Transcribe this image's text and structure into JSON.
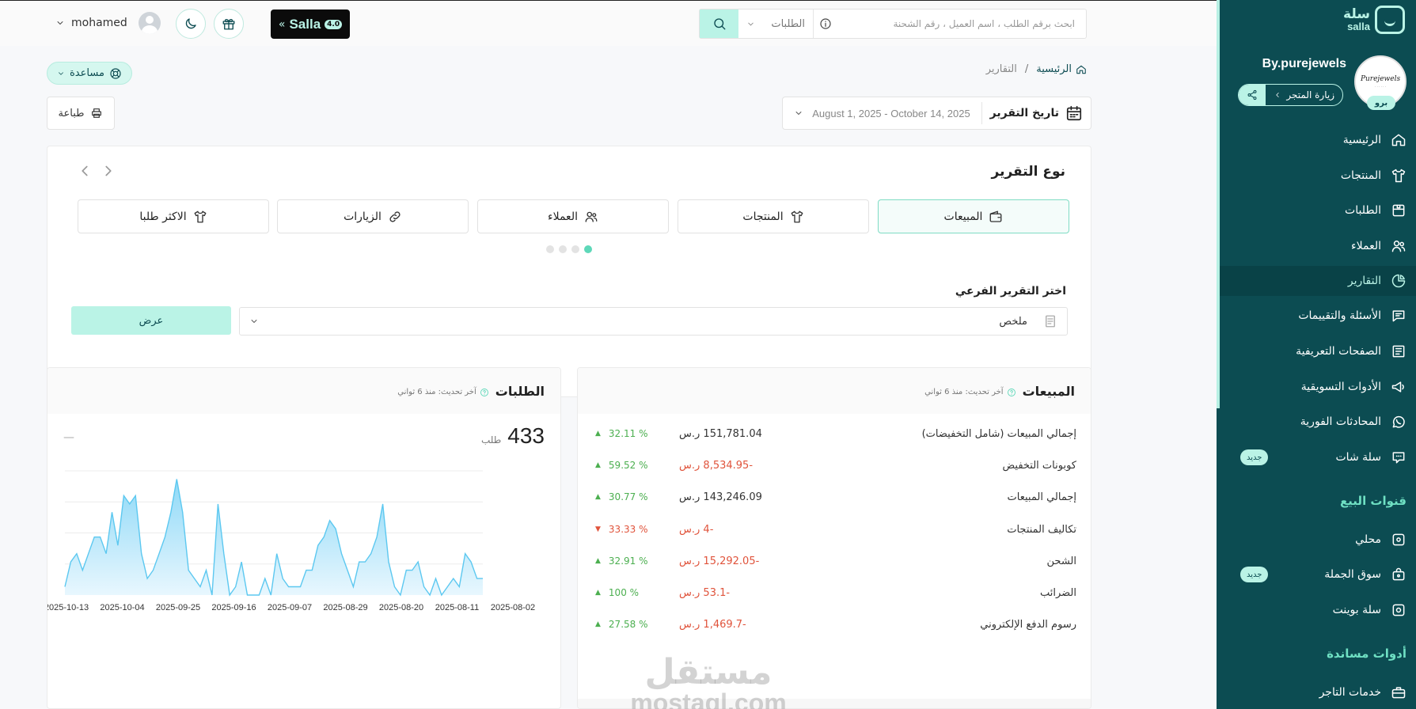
{
  "topbar": {
    "user_name": "mohamed",
    "salla_badge": {
      "label": "Salla",
      "version": "4.0"
    },
    "search": {
      "scope": "الطلبات",
      "placeholder": "ابحث برقم الطلب ، اسم العميل ، رقم الشحنة",
      "value": ""
    }
  },
  "sidebar": {
    "logo_ar": "سلة",
    "logo_en": "salla",
    "store_name": "By.purejewels",
    "store_logo_text": "Purejewels",
    "plan_badge": "برو",
    "visit_store": "زيارة المتجر",
    "nav": [
      {
        "label": "الرئيسية",
        "icon": "home-icon"
      },
      {
        "label": "المنتجات",
        "icon": "shirt-icon"
      },
      {
        "label": "الطلبات",
        "icon": "box-icon"
      },
      {
        "label": "العملاء",
        "icon": "users-icon"
      },
      {
        "label": "التقارير",
        "icon": "pie-chart-icon",
        "active": true
      },
      {
        "label": "الأسئلة والتقييمات",
        "icon": "comment-icon"
      },
      {
        "label": "الصفحات التعريفية",
        "icon": "newspaper-icon"
      },
      {
        "label": "الأدوات التسويقية",
        "icon": "megaphone-icon"
      },
      {
        "label": "المحادثات الفورية",
        "icon": "whatsapp-icon"
      },
      {
        "label": "سلة شات",
        "icon": "chat-icon",
        "badge": "جديد"
      }
    ],
    "sales_channels_title": "قنوات البيع",
    "sales_channels": [
      {
        "label": "محلي",
        "icon": "store-icon"
      },
      {
        "label": "سوق الجملة",
        "icon": "bag-icon",
        "badge": "جديد"
      },
      {
        "label": "سلة بوينت",
        "icon": "point-icon"
      }
    ],
    "tools_title": "أدوات مساندة",
    "tools": [
      {
        "label": "خدمات التاجر",
        "icon": "briefcase-icon"
      }
    ]
  },
  "header": {
    "help": "مساعدة",
    "breadcrumb": {
      "home": "الرئيسية",
      "current": "التقارير"
    },
    "print": "طباعة",
    "date_label": "تاريخ التقرير",
    "date_range": "August 1, 2025 - October 14, 2025"
  },
  "report": {
    "title": "نوع التقرير",
    "types": [
      {
        "label": "المبيعات",
        "icon": "wallet-icon",
        "active": true
      },
      {
        "label": "المنتجات",
        "icon": "shirt-icon"
      },
      {
        "label": "العملاء",
        "icon": "users-icon"
      },
      {
        "label": "الزيارات",
        "icon": "link-icon"
      },
      {
        "label": "الاكثر طلبا",
        "icon": "shirt-icon"
      }
    ],
    "sub_label": "اختر التقرير الفرعي",
    "sub_value": "ملخص",
    "show_button": "عرض"
  },
  "sales_card": {
    "title": "المبيعات",
    "updated": "آخر تحديث: منذ 6 ثواني",
    "rows": [
      {
        "label": "إجمالي المبيعات (شامل التخفيضات)",
        "amount": "151,781.04 ر.س",
        "negative": false,
        "percent": "32.11 %",
        "trend": "up"
      },
      {
        "label": "كوبونات التخفيض",
        "amount": "-8,534.95 ر.س",
        "negative": true,
        "percent": "59.52 %",
        "trend": "up"
      },
      {
        "label": "إجمالي المبيعات",
        "amount": "143,246.09 ر.س",
        "negative": false,
        "percent": "30.77 %",
        "trend": "up"
      },
      {
        "label": "تكاليف المنتجات",
        "amount": "-4 ر.س",
        "negative": true,
        "percent": "33.33 %",
        "trend": "down"
      },
      {
        "label": "الشحن",
        "amount": "-15,292.05 ر.س",
        "negative": true,
        "percent": "32.91 %",
        "trend": "up"
      },
      {
        "label": "الضرائب",
        "amount": "-53.1 ر.س",
        "negative": true,
        "percent": "100 %",
        "trend": "up"
      },
      {
        "label": "رسوم الدفع الإلكتروني",
        "amount": "-1,469.7 ر.س",
        "negative": true,
        "percent": "27.58 %",
        "trend": "up"
      }
    ]
  },
  "orders_card": {
    "title": "الطلبات",
    "updated": "آخر تحديث: منذ 6 ثواني",
    "count": "433",
    "unit": "طلب",
    "dash": "—"
  },
  "chart_data": {
    "type": "area",
    "x_ticks": [
      "2025-10-13",
      "2025-10-04",
      "2025-09-25",
      "2025-09-16",
      "2025-09-07",
      "2025-08-29",
      "2025-08-20",
      "2025-08-11",
      "2025-08-02"
    ],
    "values": [
      1,
      4,
      5,
      3,
      5,
      7,
      7,
      5,
      10,
      6,
      12,
      11,
      12,
      5,
      2,
      3,
      5,
      7,
      10,
      14,
      10,
      3,
      2,
      1,
      3,
      0,
      11,
      5,
      0,
      1,
      4,
      0,
      0,
      0,
      2,
      0,
      5,
      2,
      1,
      1,
      1,
      3,
      3,
      6,
      7,
      9,
      8,
      5,
      3,
      1,
      4,
      4,
      5,
      7,
      11,
      4,
      1,
      0,
      3,
      3,
      4,
      1,
      0,
      2,
      0,
      1,
      2,
      1,
      5,
      4,
      2,
      2
    ],
    "ylim": [
      0,
      15
    ],
    "grid": true,
    "colors": {
      "line": "#5cc8f0",
      "fill_top": "#8fd9f7",
      "fill_bottom": "#e8f7fe"
    }
  },
  "watermark": {
    "ar": "مستقل",
    "en": "mostaql.com"
  }
}
